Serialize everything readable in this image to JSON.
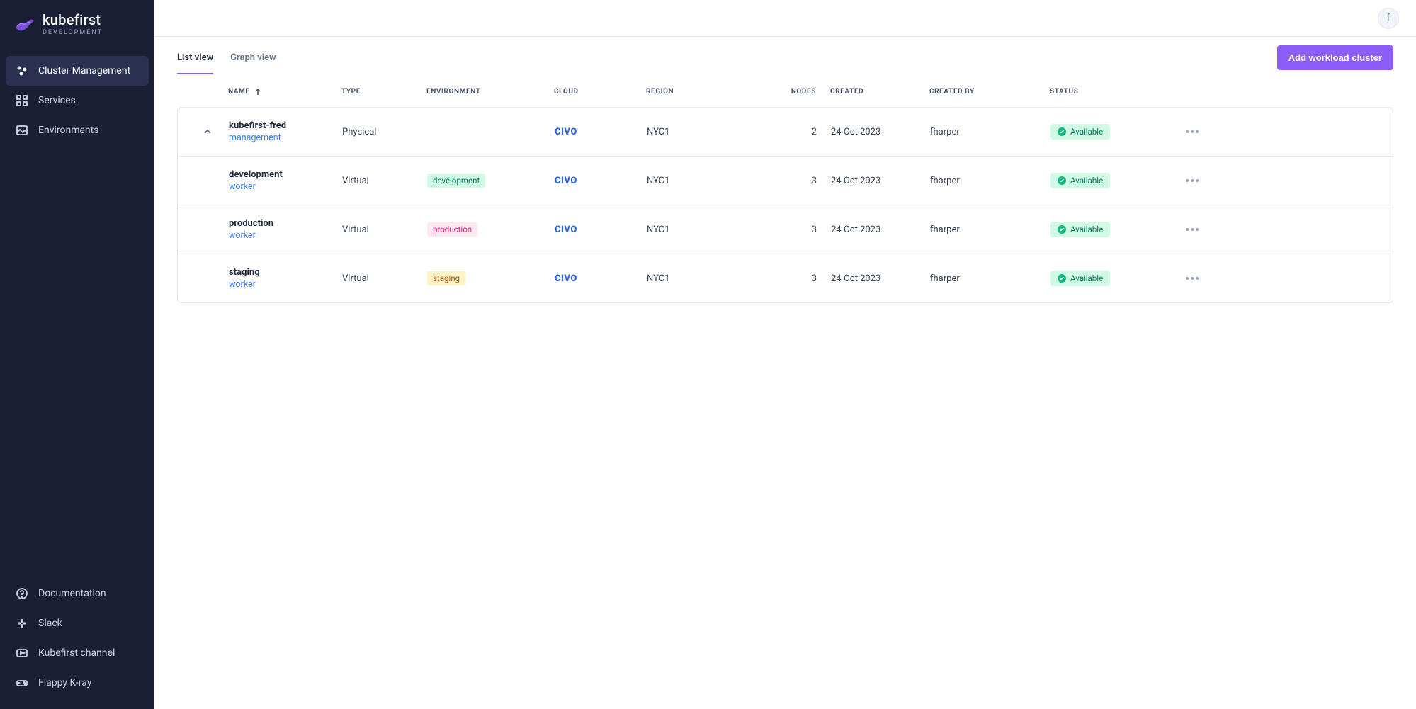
{
  "brand": {
    "name": "kubefirst",
    "tag": "DEVELOPMENT"
  },
  "sidebar": {
    "main": [
      {
        "label": "Cluster Management",
        "active": true
      },
      {
        "label": "Services",
        "active": false
      },
      {
        "label": "Environments",
        "active": false
      }
    ],
    "bottom": [
      {
        "label": "Documentation"
      },
      {
        "label": "Slack"
      },
      {
        "label": "Kubefirst channel"
      },
      {
        "label": "Flappy K-ray"
      }
    ]
  },
  "user": {
    "initial": "f"
  },
  "tabs": {
    "list": "List view",
    "graph": "Graph view"
  },
  "actions": {
    "add": "Add workload cluster"
  },
  "columns": {
    "name": "NAME",
    "type": "TYPE",
    "environment": "ENVIRONMENT",
    "cloud": "CLOUD",
    "region": "REGION",
    "nodes": "NODES",
    "created": "CREATED",
    "createdBy": "CREATED BY",
    "status": "STATUS"
  },
  "clusters": [
    {
      "name": "kubefirst-fred",
      "role": "management",
      "type": "Physical",
      "environment": "",
      "envClass": "",
      "cloud": "CIVO",
      "region": "NYC1",
      "nodes": "2",
      "created": "24 Oct 2023",
      "createdBy": "fharper",
      "status": "Available",
      "expanded": true
    },
    {
      "name": "development",
      "role": "worker",
      "type": "Virtual",
      "environment": "development",
      "envClass": "env-development",
      "cloud": "CIVO",
      "region": "NYC1",
      "nodes": "3",
      "created": "24 Oct 2023",
      "createdBy": "fharper",
      "status": "Available",
      "expanded": false
    },
    {
      "name": "production",
      "role": "worker",
      "type": "Virtual",
      "environment": "production",
      "envClass": "env-production",
      "cloud": "CIVO",
      "region": "NYC1",
      "nodes": "3",
      "created": "24 Oct 2023",
      "createdBy": "fharper",
      "status": "Available",
      "expanded": false
    },
    {
      "name": "staging",
      "role": "worker",
      "type": "Virtual",
      "environment": "staging",
      "envClass": "env-staging",
      "cloud": "CIVO",
      "region": "NYC1",
      "nodes": "3",
      "created": "24 Oct 2023",
      "createdBy": "fharper",
      "status": "Available",
      "expanded": false
    }
  ]
}
